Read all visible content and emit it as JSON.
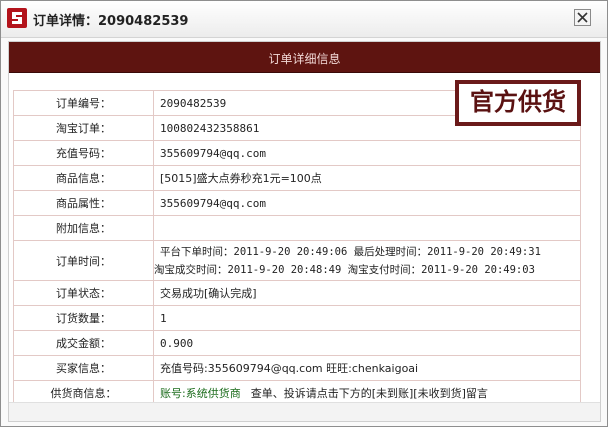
{
  "window": {
    "title": "订单详情：2090482539",
    "close_label": "×"
  },
  "banner": {
    "title": "订单详细信息"
  },
  "stamp": {
    "text": "官方供货"
  },
  "rows": {
    "order_no": {
      "label": "订单编号：",
      "value": "2090482539"
    },
    "taobao_no": {
      "label": "淘宝订单：",
      "value": "100802432358861"
    },
    "recharge": {
      "label": "充值号码：",
      "value": "355609794@qq.com"
    },
    "product": {
      "label": "商品信息：",
      "value": "[5015]盛大点券秒充1元=100点"
    },
    "attr": {
      "label": "商品属性：",
      "value": "355609794@qq.com"
    },
    "extra": {
      "label": "附加信息：",
      "value": ""
    },
    "time": {
      "label": "订单时间：",
      "line1": "平台下单时间：2011-9-20 20:49:06   最后处理时间：2011-9-20 20:49:31",
      "line2": "淘宝成交时间：2011-9-20 20:48:49 淘宝支付时间：2011-9-20 20:49:03"
    },
    "status": {
      "label": "订单状态：",
      "value": "交易成功[确认完成]"
    },
    "qty": {
      "label": "订货数量：",
      "value": "1"
    },
    "amount": {
      "label": "成交金额：",
      "value": "0.900"
    },
    "buyer": {
      "label": "买家信息：",
      "value": "充值号码:355609794@qq.com 旺旺:chenkaigoai"
    },
    "supplier": {
      "label": "供货商信息：",
      "account": "账号:系统供货商",
      "note": "查单、投诉请点击下方的[未到账][未收到货]留言"
    }
  },
  "colors": {
    "banner": "#5e1410",
    "stamp": "#6b1a1a",
    "status_green": "#1a6b1a",
    "row_border": "#e3c9c6"
  }
}
